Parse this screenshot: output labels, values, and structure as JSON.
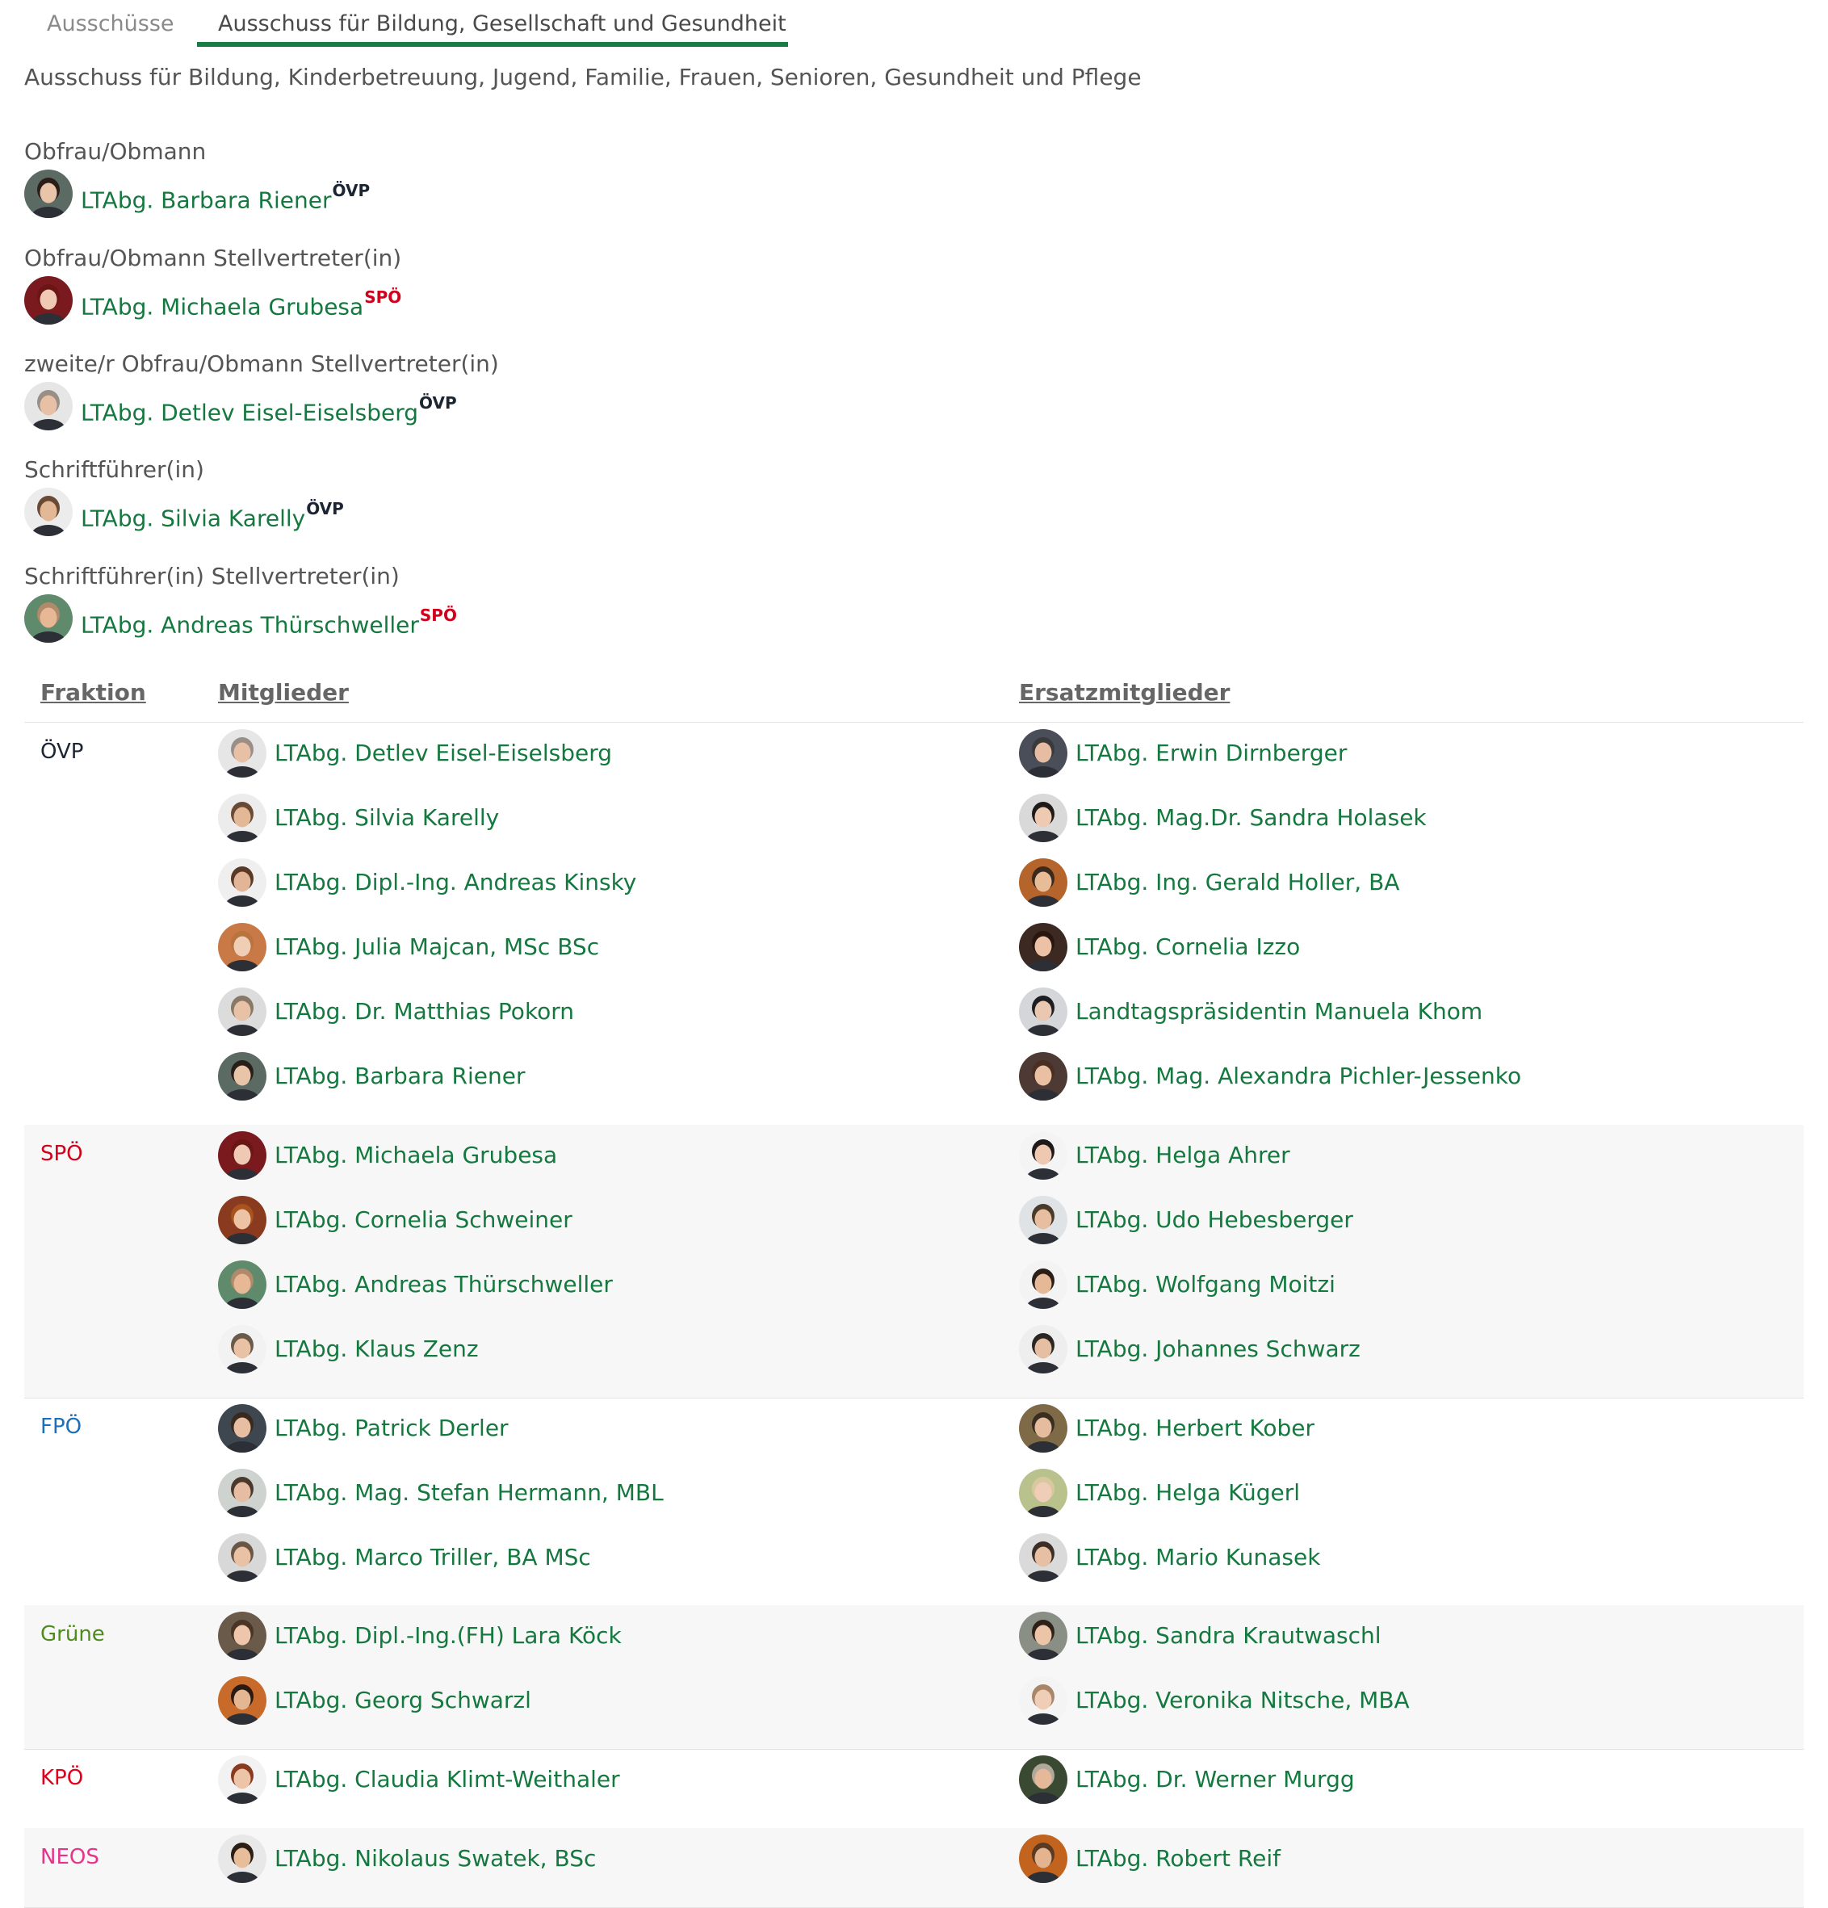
{
  "colors": {
    "link": "#14783f",
    "accent": "#1a7c45",
    "OEVP": "#1c2532",
    "SPOE": "#d0011b",
    "FPOE": "#1d6fb8",
    "GRUENE": "#4f8b1d",
    "KPOE": "#e4001c",
    "NEOS": "#e6348c"
  },
  "tabs": [
    "Ausschüsse",
    "Ausschuss für Bildung, Gesellschaft und Gesundheit"
  ],
  "subtitle": "Ausschuss für Bildung, Kinderbetreuung, Jugend, Familie, Frauen, Senioren, Gesundheit und Pflege",
  "roles": [
    {
      "title": "Obfrau/Obmann",
      "name": "LTAbg. Barbara Riener",
      "party": "ÖVP",
      "party_color": "#1c2532",
      "avatar_bg": "#5b6b63",
      "skin": "#e8c4a8",
      "hair": "#2a1e18"
    },
    {
      "title": "Obfrau/Obmann Stellvertreter(in)",
      "name": "LTAbg. Michaela Grubesa",
      "party": "SPÖ",
      "party_color": "#d0011b",
      "avatar_bg": "#7a1a1e",
      "skin": "#efc9b3",
      "hair": "#6b1616"
    },
    {
      "title": "zweite/r Obfrau/Obmann Stellvertreter(in)",
      "name": "LTAbg. Detlev Eisel-Eiselsberg",
      "party": "ÖVP",
      "party_color": "#1c2532",
      "avatar_bg": "#e6e6e6",
      "skin": "#e8c0a6",
      "hair": "#9a8f86"
    },
    {
      "title": "Schriftführer(in)",
      "name": "LTAbg. Silvia Karelly",
      "party": "ÖVP",
      "party_color": "#1c2532",
      "avatar_bg": "#ececec",
      "skin": "#e3b896",
      "hair": "#6a4a34"
    },
    {
      "title": "Schriftführer(in) Stellvertreter(in)",
      "name": "LTAbg. Andreas Thürschweller",
      "party": "SPÖ",
      "party_color": "#d0011b",
      "avatar_bg": "#5f8a6c",
      "skin": "#e7b896",
      "hair": "#b08a6a"
    }
  ],
  "table": {
    "headers": {
      "fraktion": "Fraktion",
      "mitglieder": "Mitglieder",
      "ersatz": "Ersatzmitglieder"
    },
    "groups": [
      {
        "party": "ÖVP",
        "color": "#1c2532",
        "members": [
          {
            "name": "LTAbg. Detlev Eisel-Eiselsberg",
            "avatar_bg": "#e6e6e6",
            "skin": "#e8c0a6",
            "hair": "#9a8f86"
          },
          {
            "name": "LTAbg. Silvia Karelly",
            "avatar_bg": "#ececec",
            "skin": "#e3b896",
            "hair": "#6a4a34"
          },
          {
            "name": "LTAbg. Dipl.-Ing. Andreas Kinsky",
            "avatar_bg": "#efefef",
            "skin": "#e3b597",
            "hair": "#5a3a26"
          },
          {
            "name": "LTAbg. Julia Majcan, MSc BSc",
            "avatar_bg": "#c87945",
            "skin": "#f0cdb5",
            "hair": "#b8743e"
          },
          {
            "name": "LTAbg. Dr. Matthias Pokorn",
            "avatar_bg": "#dcdcdc",
            "skin": "#e8c2a6",
            "hair": "#8a7866"
          },
          {
            "name": "LTAbg. Barbara Riener",
            "avatar_bg": "#5b6b63",
            "skin": "#e8c4a8",
            "hair": "#2a1e18"
          }
        ],
        "substitutes": [
          {
            "name": "LTAbg. Erwin Dirnberger",
            "avatar_bg": "#4a4e58",
            "skin": "#e6bda2",
            "hair": "#3a3a3a"
          },
          {
            "name": "LTAbg. Mag.Dr. Sandra Holasek",
            "avatar_bg": "#d9d9d9",
            "skin": "#efcab2",
            "hair": "#1e1a18"
          },
          {
            "name": "LTAbg. Ing. Gerald Holler, BA",
            "avatar_bg": "#b5642c",
            "skin": "#e9bc98",
            "hair": "#3a2a1e"
          },
          {
            "name": "LTAbg. Cornelia Izzo",
            "avatar_bg": "#3c2a22",
            "skin": "#ecc2a6",
            "hair": "#2a160e"
          },
          {
            "name": "Landtagspräsidentin Manuela Khom",
            "avatar_bg": "#d4d6da",
            "skin": "#eac7b0",
            "hair": "#1e1e22"
          },
          {
            "name": "LTAbg. Mag. Alexandra Pichler-Jessenko",
            "avatar_bg": "#4e3a34",
            "skin": "#e9c0a4",
            "hair": "#4a2e22"
          }
        ]
      },
      {
        "party": "SPÖ",
        "color": "#d0011b",
        "members": [
          {
            "name": "LTAbg. Michaela Grubesa",
            "avatar_bg": "#7a1a1e",
            "skin": "#efc9b3",
            "hair": "#6b1616"
          },
          {
            "name": "LTAbg. Cornelia Schweiner",
            "avatar_bg": "#8a3a1e",
            "skin": "#edc3a5",
            "hair": "#a8521e"
          },
          {
            "name": "LTAbg. Andreas Thürschweller",
            "avatar_bg": "#5f8a6c",
            "skin": "#e7b896",
            "hair": "#b08a6a"
          },
          {
            "name": "LTAbg. Klaus Zenz",
            "avatar_bg": "#f2f2f2",
            "skin": "#e9c1a5",
            "hair": "#6a5a4a"
          }
        ],
        "substitutes": [
          {
            "name": "LTAbg. Helga Ahrer",
            "avatar_bg": "#f4f4f4",
            "skin": "#eec8b0",
            "hair": "#1e1a1a"
          },
          {
            "name": "LTAbg. Udo Hebesberger",
            "avatar_bg": "#dfe3e6",
            "skin": "#e8bea0",
            "hair": "#4a3a2a"
          },
          {
            "name": "LTAbg. Wolfgang Moitzi",
            "avatar_bg": "#f3f3f3",
            "skin": "#e5b896",
            "hair": "#2a1e16"
          },
          {
            "name": "LTAbg. Johannes Schwarz",
            "avatar_bg": "#eeeeee",
            "skin": "#e6bea2",
            "hair": "#2a2624"
          }
        ]
      },
      {
        "party": "FPÖ",
        "color": "#1d6fb8",
        "members": [
          {
            "name": "LTAbg. Patrick Derler",
            "avatar_bg": "#3e4650",
            "skin": "#e8bea2",
            "hair": "#3a2a1e"
          },
          {
            "name": "LTAbg. Mag. Stefan Hermann, MBL",
            "avatar_bg": "#cfd3cf",
            "skin": "#e6bda2",
            "hair": "#4a3a2e"
          },
          {
            "name": "LTAbg. Marco Triller, BA MSc",
            "avatar_bg": "#d8d8d8",
            "skin": "#e9c1a4",
            "hair": "#6a5644"
          }
        ],
        "substitutes": [
          {
            "name": "LTAbg. Herbert Kober",
            "avatar_bg": "#7e6a46",
            "skin": "#e6bc9e",
            "hair": "#3a2e22"
          },
          {
            "name": "LTAbg. Helga Kügerl",
            "avatar_bg": "#b9c28c",
            "skin": "#efcdb6",
            "hair": "#d8c8a0"
          },
          {
            "name": "LTAbg. Mario Kunasek",
            "avatar_bg": "#dadada",
            "skin": "#e7bfa2",
            "hair": "#3a2e26"
          }
        ]
      },
      {
        "party": "Grüne",
        "color": "#4f8b1d",
        "members": [
          {
            "name": "LTAbg. Dipl.-Ing.(FH) Lara Köck",
            "avatar_bg": "#6a5a4a",
            "skin": "#edc6ac",
            "hair": "#4a3426"
          },
          {
            "name": "LTAbg. Georg Schwarzl",
            "avatar_bg": "#c86a2a",
            "skin": "#e4b692",
            "hair": "#2a1a12"
          }
        ],
        "substitutes": [
          {
            "name": "LTAbg. Sandra Krautwaschl",
            "avatar_bg": "#8a8f86",
            "skin": "#ecc4a8",
            "hair": "#2e2218"
          },
          {
            "name": "LTAbg. Veronika Nitsche, MBA",
            "avatar_bg": "#f4f4f4",
            "skin": "#f0cdb6",
            "hair": "#a8866a"
          }
        ]
      },
      {
        "party": "KPÖ",
        "color": "#e4001c",
        "members": [
          {
            "name": "LTAbg. Claudia Klimt-Weithaler",
            "avatar_bg": "#f2f2f2",
            "skin": "#ecc4a8",
            "hair": "#8a3a1e"
          }
        ],
        "substitutes": [
          {
            "name": "LTAbg. Dr. Werner Murgg",
            "avatar_bg": "#3a4a32",
            "skin": "#e4b898",
            "hair": "#b0a89a"
          }
        ]
      },
      {
        "party": "NEOS",
        "color": "#e6348c",
        "members": [
          {
            "name": "LTAbg. Nikolaus Swatek, BSc",
            "avatar_bg": "#e8e8e8",
            "skin": "#e8bd9a",
            "hair": "#2a1e16"
          }
        ],
        "substitutes": [
          {
            "name": "LTAbg. Robert Reif",
            "avatar_bg": "#c2641e",
            "skin": "#e4b490",
            "hair": "#5a3a22"
          }
        ]
      }
    ]
  }
}
